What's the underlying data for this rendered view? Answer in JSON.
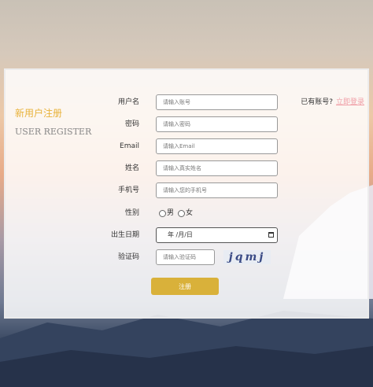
{
  "page": {
    "title_cn": "新用户注册",
    "title_en": "USER REGISTER",
    "login_prompt": "已有账号?",
    "login_link": "立即登录"
  },
  "form": {
    "fields": [
      {
        "label": "用户名",
        "placeholder": "请输入账号"
      },
      {
        "label": "密码",
        "placeholder": "请输入密码"
      },
      {
        "label": "Email",
        "placeholder": "请输入Email"
      },
      {
        "label": "姓名",
        "placeholder": "请输入真实姓名"
      },
      {
        "label": "手机号",
        "placeholder": "请输入您的手机号"
      }
    ],
    "gender": {
      "label": "性别",
      "options": [
        "男",
        "女"
      ]
    },
    "birthdate": {
      "label": "出生日期",
      "value": "年 /月/日"
    },
    "captcha": {
      "label": "验证码",
      "placeholder": "请输入验证码",
      "code": "jqmj"
    },
    "submit_label": "注册"
  },
  "colors": {
    "accent": "#d9b13a",
    "title": "#e8b23a",
    "link": "#f0a0a8"
  }
}
